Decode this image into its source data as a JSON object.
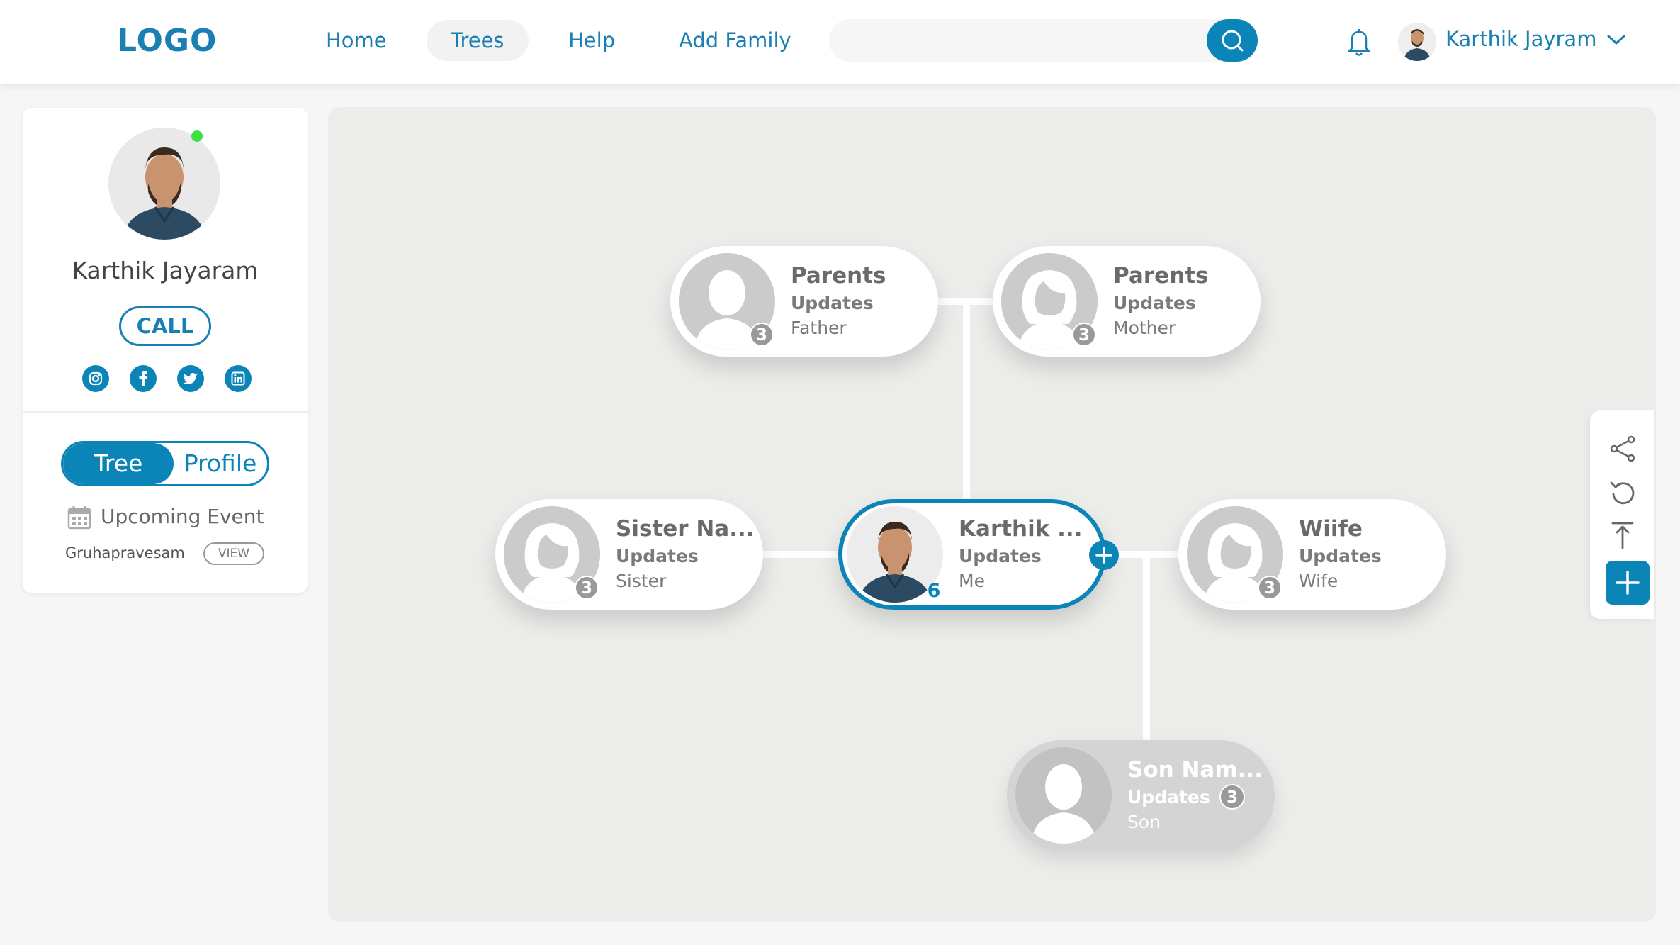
{
  "header": {
    "logo": "LOGO",
    "nav": [
      "Home",
      "Trees",
      "Help",
      "Add Family"
    ],
    "active_nav": "Trees",
    "search_placeholder": "",
    "user_name": "Karthik Jayram"
  },
  "sidebar": {
    "name": "Karthik Jayaram",
    "call_label": "CALL",
    "social_icons": [
      "instagram-icon",
      "facebook-icon",
      "twitter-icon",
      "linkedin-icon"
    ],
    "toggle": {
      "tree": "Tree",
      "profile": "Profile",
      "selected": "Tree"
    },
    "upcoming_label": "Upcoming Event",
    "event_name": "Gruhapravesam",
    "view_label": "VIEW"
  },
  "tree": {
    "father": {
      "title": "Parents",
      "updates": "Updates",
      "relation": "Father",
      "count": "3"
    },
    "mother": {
      "title": "Parents",
      "updates": "Updates",
      "relation": "Mother",
      "count": "3"
    },
    "sister": {
      "title": "Sister Na...",
      "updates": "Updates",
      "relation": "Sister",
      "count": "3"
    },
    "me": {
      "title": "Karthik ...",
      "updates": "Updates",
      "relation": "Me",
      "count": "6"
    },
    "wife": {
      "title": "Wiife",
      "updates": "Updates",
      "relation": "Wife",
      "count": "3"
    },
    "son": {
      "title": "Son Nam...",
      "updates": "Updates",
      "relation": "Son",
      "count": "3"
    }
  },
  "toolbar": [
    "share-icon",
    "refresh-icon",
    "collapse-top-icon",
    "add-icon"
  ],
  "colors": {
    "primary": "#0b84b8",
    "online": "#3ee042",
    "canvas": "#ececea"
  }
}
